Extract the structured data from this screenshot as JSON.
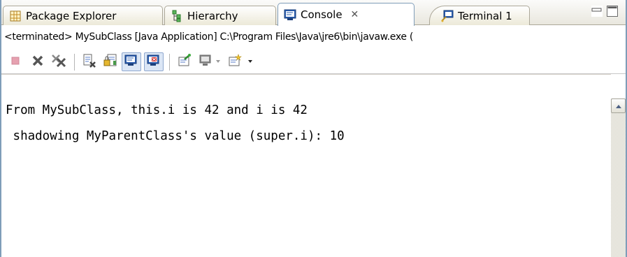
{
  "tabs": [
    {
      "label": "Package Explorer",
      "icon": "package-explorer-icon"
    },
    {
      "label": "Hierarchy",
      "icon": "hierarchy-icon"
    },
    {
      "label": "Console",
      "icon": "console-icon",
      "active": true,
      "close": "✕"
    },
    {
      "label": "Terminal 1",
      "icon": "terminal-icon"
    }
  ],
  "description": "<terminated> MySubClass [Java Application] C:\\Program Files\\Java\\jre6\\bin\\javaw.exe (",
  "toolbar": [
    "terminate-icon",
    "remove-launch-icon",
    "remove-all-terminated-icon",
    "clear-console-icon",
    "scroll-lock-icon",
    "show-console-on-stdout-icon",
    "show-console-on-stderr-icon",
    "pin-console-icon",
    "display-selected-console-icon",
    "open-console-icon"
  ],
  "console": {
    "lines": [
      "From MySubClass, this.i is 42 and i is 42",
      " shadowing MyParentClass's value (super.i): 10"
    ]
  },
  "colors": {
    "active_tab_border": "#7f9db9",
    "tab_strip": "#ece9d8",
    "pressed_button": "#dbe6f5"
  }
}
